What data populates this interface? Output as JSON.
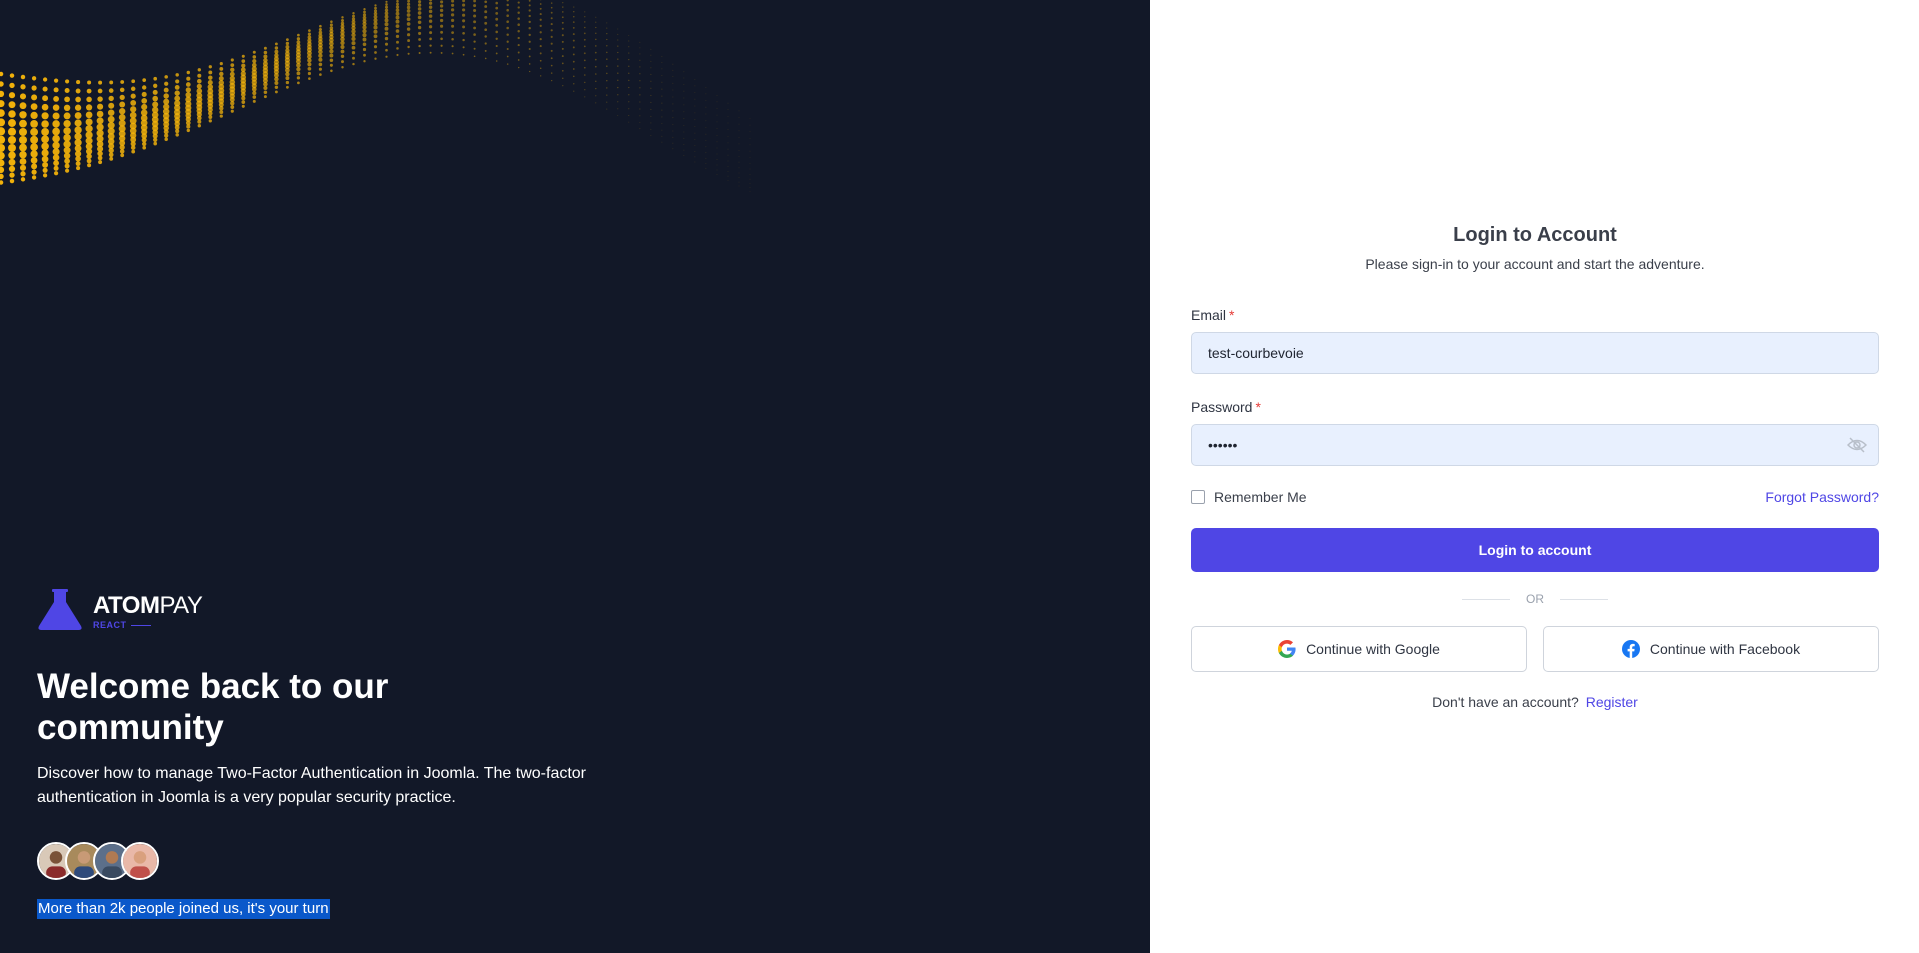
{
  "brand": {
    "name_bold": "ATOM",
    "name_light": "PAY",
    "sub": "REACT"
  },
  "hero": {
    "title": "Welcome back to our community",
    "description": "Discover how to manage Two-Factor Authentication in Joomla. The two-factor authentication in Joomla is a very popular security practice.",
    "joined_text": "More than 2k people joined us, it's your turn"
  },
  "form": {
    "title": "Login to Account",
    "subtitle": "Please sign-in to your account and start the adventure.",
    "email_label": "Email",
    "email_value": "test-courbevoie",
    "password_label": "Password",
    "password_value": "••••••",
    "required_mark": "*",
    "remember_label": "Remember Me",
    "forgot_label": "Forgot Password?",
    "login_button": "Login to account",
    "or_text": "OR",
    "google_button": "Continue with Google",
    "facebook_button": "Continue with Facebook",
    "register_prompt": "Don't have an account?",
    "register_link": "Register"
  },
  "colors": {
    "accent": "#4f46e5",
    "left_bg": "#121828",
    "wave": "#f5b40a",
    "input_bg": "#e8f0fe"
  },
  "icons": [
    "atom-flask-icon",
    "eye-off-icon",
    "google-icon",
    "facebook-icon"
  ]
}
